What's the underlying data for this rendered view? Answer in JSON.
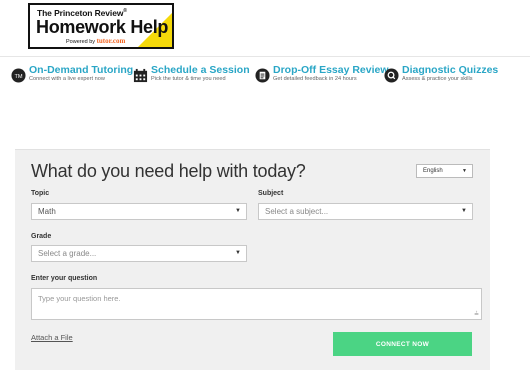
{
  "logo": {
    "line1": "The Princeton Review",
    "reg_mark": "®",
    "line2": "Homework Help",
    "powered_by": "Powered by",
    "partner": "tutor.com",
    "accent_color": "#f5d90a"
  },
  "features": [
    {
      "icon": "tutor-bubble-icon",
      "title": "On-Demand Tutoring",
      "subtitle": "Connect with a live expert now"
    },
    {
      "icon": "calendar-icon",
      "title": "Schedule a Session",
      "subtitle": "Pick the tutor & time you need"
    },
    {
      "icon": "document-icon",
      "title": "Drop-Off Essay Review",
      "subtitle": "Get detailed feedback in 24 hours"
    },
    {
      "icon": "quiz-icon",
      "title": "Diagnostic Quizzes",
      "subtitle": "Assess & practice your skills"
    }
  ],
  "form": {
    "heading": "What do you need help with today?",
    "language": "English",
    "topic_label": "Topic",
    "topic_value": "Math",
    "subject_label": "Subject",
    "subject_placeholder": "Select a subject...",
    "grade_label": "Grade",
    "grade_placeholder": "Select a grade...",
    "question_label": "Enter your question",
    "question_placeholder": "Type your question here.",
    "attach_label": "Attach a File",
    "connect_label": "CONNECT NOW"
  },
  "colors": {
    "feature_title": "#2aa6c6",
    "connect_button": "#4bd484",
    "panel_bg": "#f0f0f0"
  }
}
